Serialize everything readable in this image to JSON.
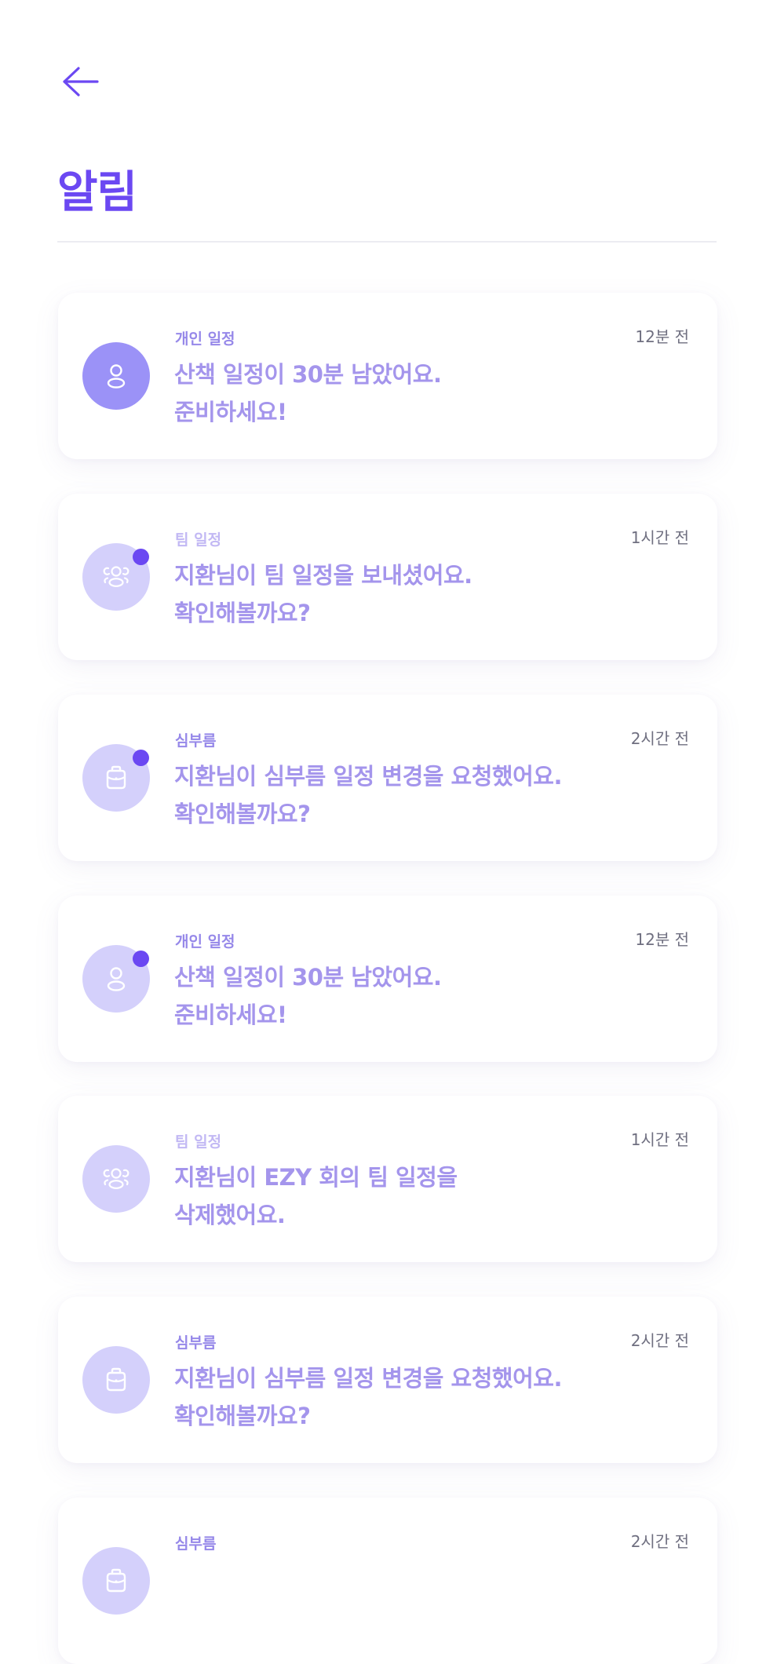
{
  "header": {
    "back_icon": "arrow-left-icon",
    "title": "알림"
  },
  "colors": {
    "accent": "#6b48f2",
    "avatar_active": "#9b92f7",
    "avatar_muted": "#d4d0fb",
    "message_text": "#a495ec",
    "time_text": "#6f6f80"
  },
  "notifications": [
    {
      "category": "개인 일정",
      "line1": "산책 일정이 30분 남았어요.",
      "line2": "준비하세요!",
      "time": "12분 전",
      "icon": "person-icon",
      "unread": false,
      "active": true
    },
    {
      "category": "팀 일정",
      "line1": "지환님이 팀 일정을 보내셨어요.",
      "line2": "확인해볼까요?",
      "time": "1시간 전",
      "icon": "team-icon",
      "unread": true,
      "active": false
    },
    {
      "category": "심부름",
      "line1": "지환님이 심부름 일정 변경을 요청했어요.",
      "line2": "확인해볼까요?",
      "time": "2시간 전",
      "icon": "bag-icon",
      "unread": true,
      "active": false
    },
    {
      "category": "개인 일정",
      "line1": "산책 일정이 30분 남았어요.",
      "line2": "준비하세요!",
      "time": "12분 전",
      "icon": "person-icon",
      "unread": true,
      "active": false
    },
    {
      "category": "팀 일정",
      "line1": "지환님이 EZY 회의 팀 일정을",
      "line2": "삭제했어요.",
      "time": "1시간 전",
      "icon": "team-icon",
      "unread": false,
      "active": false
    },
    {
      "category": "심부름",
      "line1": "지환님이 심부름 일정 변경을 요청했어요.",
      "line2": "확인해볼까요?",
      "time": "2시간 전",
      "icon": "bag-icon",
      "unread": false,
      "active": false
    },
    {
      "category": "심부름",
      "line1": "",
      "line2": "",
      "time": "2시간 전",
      "icon": "bag-icon",
      "unread": false,
      "active": false
    }
  ]
}
